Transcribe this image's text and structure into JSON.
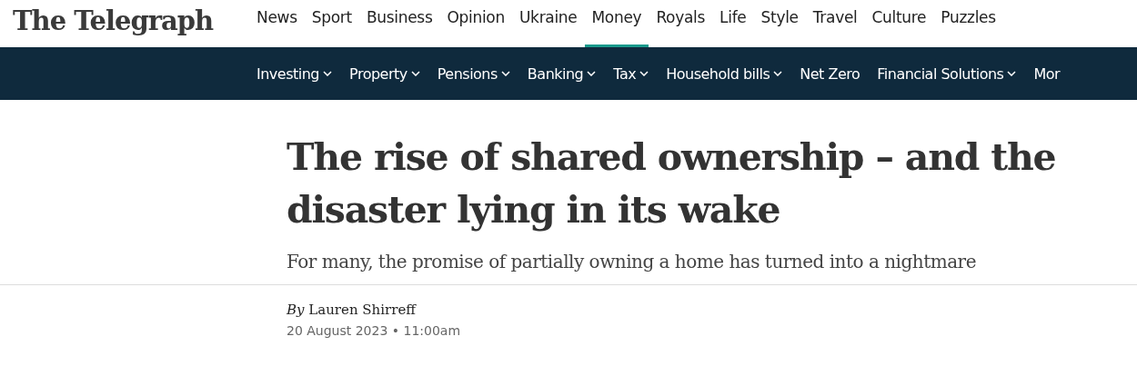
{
  "logo": "The Telegraph",
  "main_nav": [
    {
      "label": "News",
      "selected": false
    },
    {
      "label": "Sport",
      "selected": false
    },
    {
      "label": "Business",
      "selected": false
    },
    {
      "label": "Opinion",
      "selected": false
    },
    {
      "label": "Ukraine",
      "selected": false
    },
    {
      "label": "Money",
      "selected": true
    },
    {
      "label": "Royals",
      "selected": false
    },
    {
      "label": "Life",
      "selected": false
    },
    {
      "label": "Style",
      "selected": false
    },
    {
      "label": "Travel",
      "selected": false
    },
    {
      "label": "Culture",
      "selected": false
    },
    {
      "label": "Puzzles",
      "selected": false
    }
  ],
  "sub_nav": [
    {
      "label": "Investing",
      "dropdown": true
    },
    {
      "label": "Property",
      "dropdown": true
    },
    {
      "label": "Pensions",
      "dropdown": true
    },
    {
      "label": "Banking",
      "dropdown": true
    },
    {
      "label": "Tax",
      "dropdown": true
    },
    {
      "label": "Household bills",
      "dropdown": true
    },
    {
      "label": "Net Zero",
      "dropdown": false
    },
    {
      "label": "Financial Solutions",
      "dropdown": true
    },
    {
      "label": "Mor",
      "dropdown": false
    }
  ],
  "article": {
    "headline": "The rise of shared ownership – and the disaster lying in its wake",
    "standfirst": "For many, the promise of partially owning a home has turned into a nightmare",
    "byline": "*By* Lauren Shirreff",
    "date": "20 August 2023 • 11:00am"
  }
}
